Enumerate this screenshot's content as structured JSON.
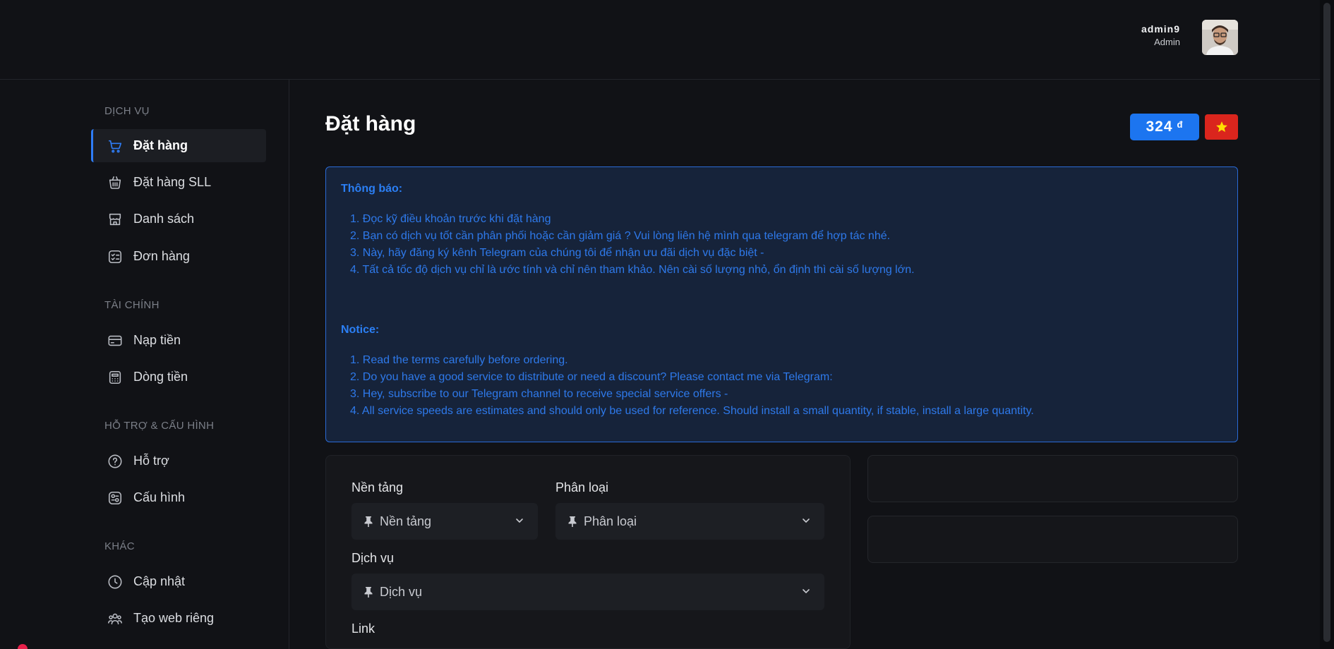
{
  "user": {
    "name": "admin9",
    "role": "Admin"
  },
  "sidebar": {
    "sections": [
      {
        "title": "DỊCH VỤ"
      },
      {
        "title": "TÀI CHÍNH"
      },
      {
        "title": "HỖ TRỢ & CẤU HÌNH"
      },
      {
        "title": "KHÁC"
      }
    ],
    "items": [
      {
        "label": "Đặt hàng",
        "icon": "cart-icon"
      },
      {
        "label": "Đặt hàng SLL",
        "icon": "basket-icon"
      },
      {
        "label": "Danh sách",
        "icon": "store-icon"
      },
      {
        "label": "Đơn hàng",
        "icon": "checklist-icon"
      },
      {
        "label": "Nạp tiền",
        "icon": "card-icon"
      },
      {
        "label": "Dòng tiền",
        "icon": "calculator-icon"
      },
      {
        "label": "Hỗ trợ",
        "icon": "help-icon"
      },
      {
        "label": "Cấu hình",
        "icon": "settings-icon"
      },
      {
        "label": "Cập nhật",
        "icon": "clock-icon"
      },
      {
        "label": "Tạo web riêng",
        "icon": "users-icon"
      }
    ]
  },
  "page": {
    "title": "Đặt hàng"
  },
  "balance": {
    "amount": "324",
    "currency": "đ"
  },
  "notice": {
    "vi_heading": "Thông báo:",
    "vi_items": [
      "1. Đọc kỹ điều khoản trước khi đặt hàng",
      "2. Bạn có dịch vụ tốt cần phân phối hoặc cần giảm giá ? Vui lòng liên hệ mình qua telegram để hợp tác nhé.",
      "3. Này, hãy đăng ký kênh Telegram của chúng tôi để nhận ưu đãi dịch vụ đặc biệt -",
      "4. Tất cả tốc độ dịch vụ chỉ là ước tính và chỉ nên tham khảo. Nên cài số lượng nhỏ, ổn định thì cài số lượng lớn."
    ],
    "en_heading": "Notice:",
    "en_items": [
      "1. Read the terms carefully before ordering.",
      "2. Do you have a good service to distribute or need a discount? Please contact me via Telegram:",
      "3. Hey, subscribe to our Telegram channel to receive special service offers -",
      "4. All service speeds are estimates and should only be used for reference. Should install a small quantity, if stable, install a large quantity."
    ]
  },
  "form": {
    "platform_label": "Nền tảng",
    "platform_value": "Nền tảng",
    "category_label": "Phân loại",
    "category_value": "Phân loại",
    "service_label": "Dịch vụ",
    "service_value": "Dịch vụ",
    "link_label": "Link"
  },
  "colors": {
    "accent": "#1c75f0",
    "notice_text": "#2e79ea",
    "flag_red": "#da251d",
    "flag_star": "#ffde00"
  }
}
